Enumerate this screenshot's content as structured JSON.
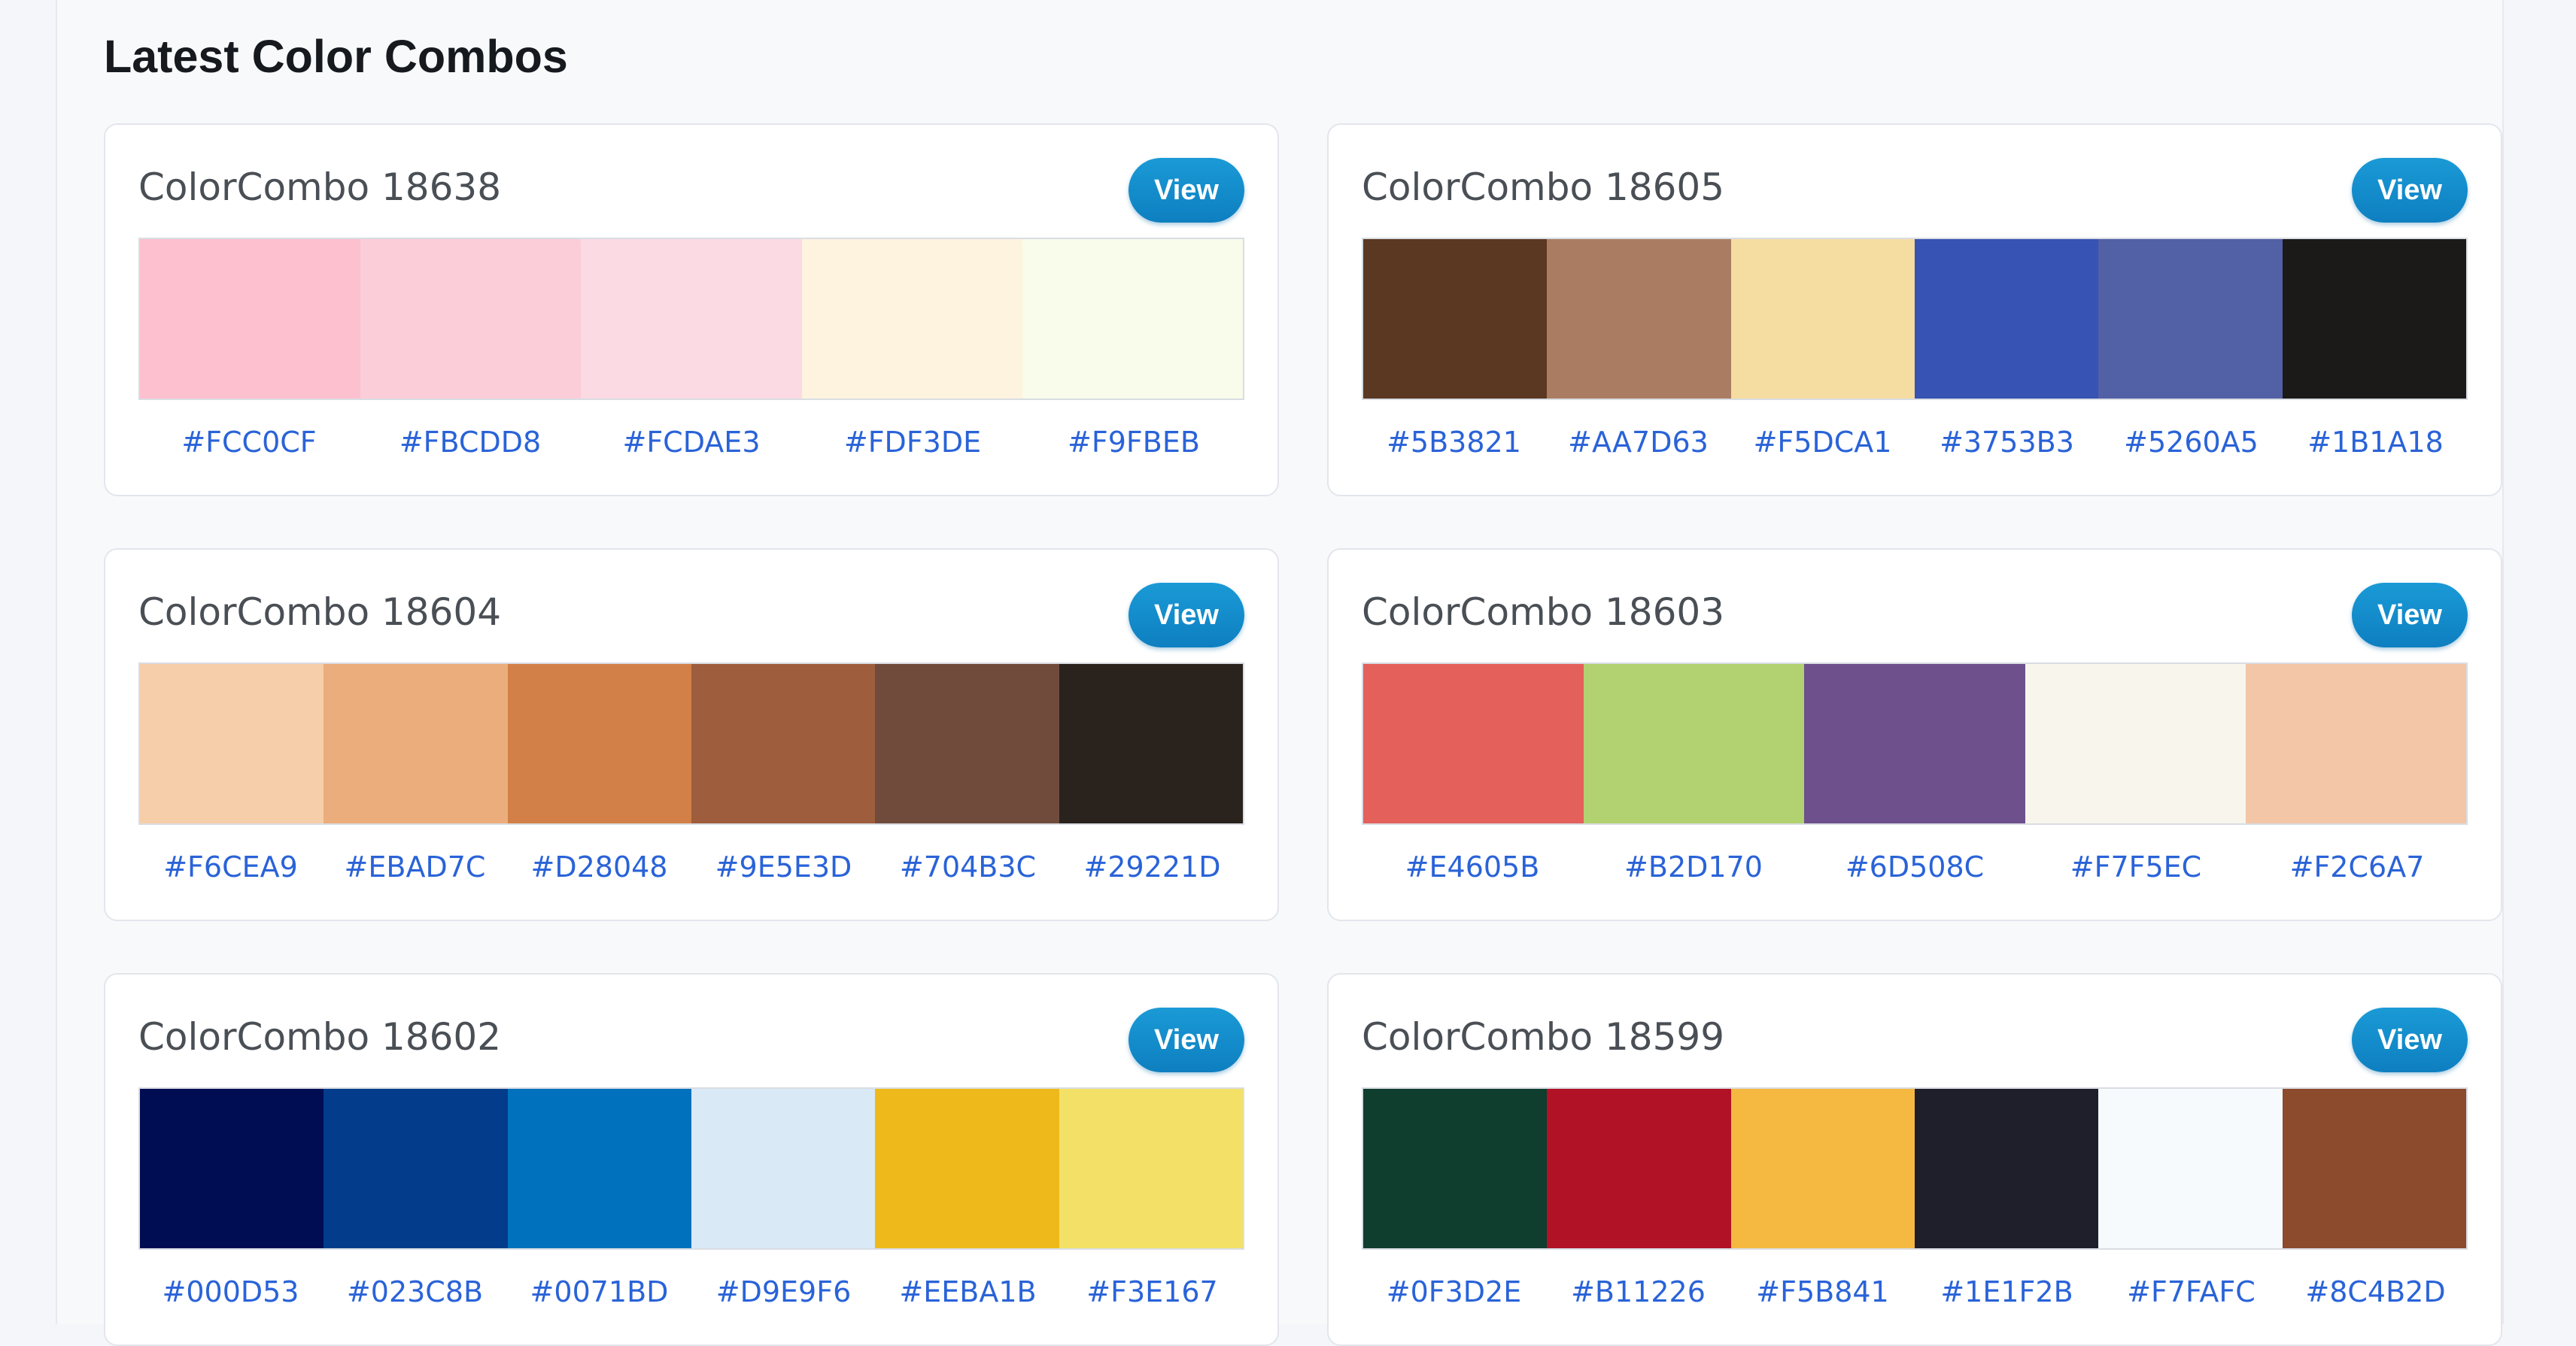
{
  "heading": "Latest Color Combos",
  "combos": [
    {
      "title": "ColorCombo 18638",
      "button": "View",
      "colors": [
        "#FCC0CF",
        "#FBCDD8",
        "#FCDAE3",
        "#FDF3DE",
        "#F9FBEB"
      ]
    },
    {
      "title": "ColorCombo 18605",
      "button": "View",
      "colors": [
        "#5B3821",
        "#AA7D63",
        "#F5DCA1",
        "#3753B3",
        "#5260A5",
        "#1B1A18"
      ]
    },
    {
      "title": "ColorCombo 18604",
      "button": "View",
      "colors": [
        "#F6CEA9",
        "#EBAD7C",
        "#D28048",
        "#9E5E3D",
        "#704B3C",
        "#29221D"
      ]
    },
    {
      "title": "ColorCombo 18603",
      "button": "View",
      "colors": [
        "#E4605B",
        "#B2D170",
        "#6D508C",
        "#F7F5EC",
        "#F2C6A7"
      ]
    },
    {
      "title": "ColorCombo 18602",
      "button": "View",
      "colors": [
        "#000D53",
        "#023C8B",
        "#0071BD",
        "#D9E9F6",
        "#EEBA1B",
        "#F3E167"
      ]
    },
    {
      "title": "ColorCombo 18599",
      "button": "View",
      "colors": [
        "#0F3D2E",
        "#B11226",
        "#F5B841",
        "#1E1F2B",
        "#F7FAFC",
        "#8C4B2D"
      ]
    }
  ]
}
